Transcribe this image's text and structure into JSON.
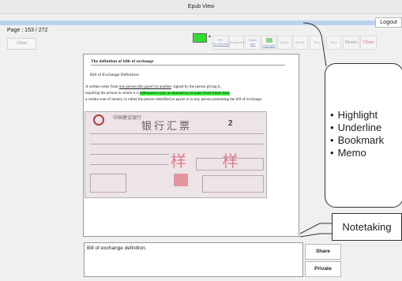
{
  "window": {
    "title": "Epub View"
  },
  "header": {
    "logout_label": "Logout",
    "page_indicator": "Page : 153 / 272",
    "other_label": "Other"
  },
  "toolbar": {
    "color": "#2fdc2f",
    "my_bookmarks_label": [
      "My",
      "bookmarks"
    ],
    "bookmark_label": "bookmark",
    "underline_label": [
      "Under",
      "line"
    ],
    "highlight_label": "highlight",
    "zoom_in_label": "Zoom+",
    "zoom_out_label": "Zoom-",
    "prev_label": "Prev",
    "next_label": "Next",
    "memo_label": "Memo",
    "close_label": "Close"
  },
  "reader": {
    "title": "The definition of bills of exchange",
    "subtitle": "Bill of Exchange Definition:",
    "lines": [
      {
        "before": "A written order from ",
        "underlined": "one person (the payer) to another",
        "after": ", signed by the person giving it,"
      },
      {
        "before": "requiring the person to whom it is ",
        "highlighted": "addressed to pay on demand or at some fixed future date,",
        "after": ""
      },
      {
        "text": "a certain sum of money, to either the person identified as payee or to any person presenting the bill of exchange."
      }
    ],
    "cheque": {
      "bank": "中国建设银行",
      "name": "银行汇票",
      "number": "2",
      "stamp": "样 样"
    }
  },
  "annotations": {
    "features": [
      "Highlight",
      "Underline",
      "Bookmark",
      "Memo"
    ],
    "notetaking_label": "Notetaking"
  },
  "memo": {
    "text": "Bill of exchange definition.",
    "share_label": "Share",
    "private_label": "Private"
  }
}
